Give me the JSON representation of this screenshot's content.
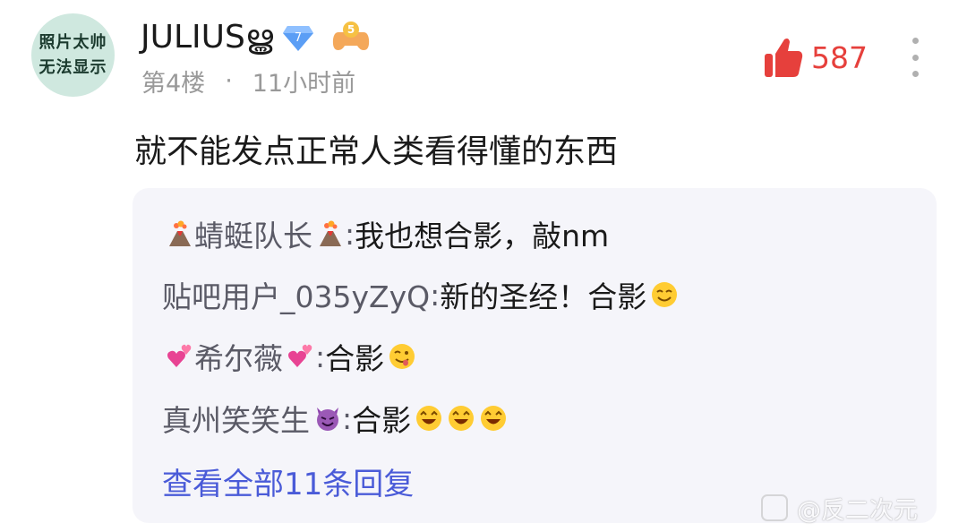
{
  "post": {
    "avatar_lines": [
      "照片太帅",
      "无法显示"
    ],
    "username": "JULIUSൠ",
    "level": "7",
    "game_level": "5",
    "floor": "第4楼",
    "separator": "·",
    "time": "11小时前",
    "likes": "587",
    "content": "就不能发点正常人类看得懂的东西"
  },
  "replies": [
    {
      "author": "蜻蜓队长",
      "sep": ": ",
      "text": "我也想合影，敲nm"
    },
    {
      "author": "贴吧用户_035yZyQ",
      "sep": ": ",
      "text": "新的圣经！合影"
    },
    {
      "author": "希尔薇",
      "sep": ": ",
      "text": "合影"
    },
    {
      "author": "真州笑笑生",
      "sep": ": ",
      "text": "合影"
    }
  ],
  "view_all": "查看全部11条回复",
  "watermark": "@反二次元",
  "colors": {
    "like": "#e6403c",
    "link": "#4a5bd8",
    "reply_bg": "#f5f5fa"
  },
  "icons": {
    "volcano": "volcano-emoji",
    "hearts": "two-hearts-emoji",
    "devil": "smiling-devil-emoji",
    "smile": "smiling-face-emoji",
    "yum": "face-savoring-food-emoji",
    "star_eyes": "star-struck-emoji"
  }
}
